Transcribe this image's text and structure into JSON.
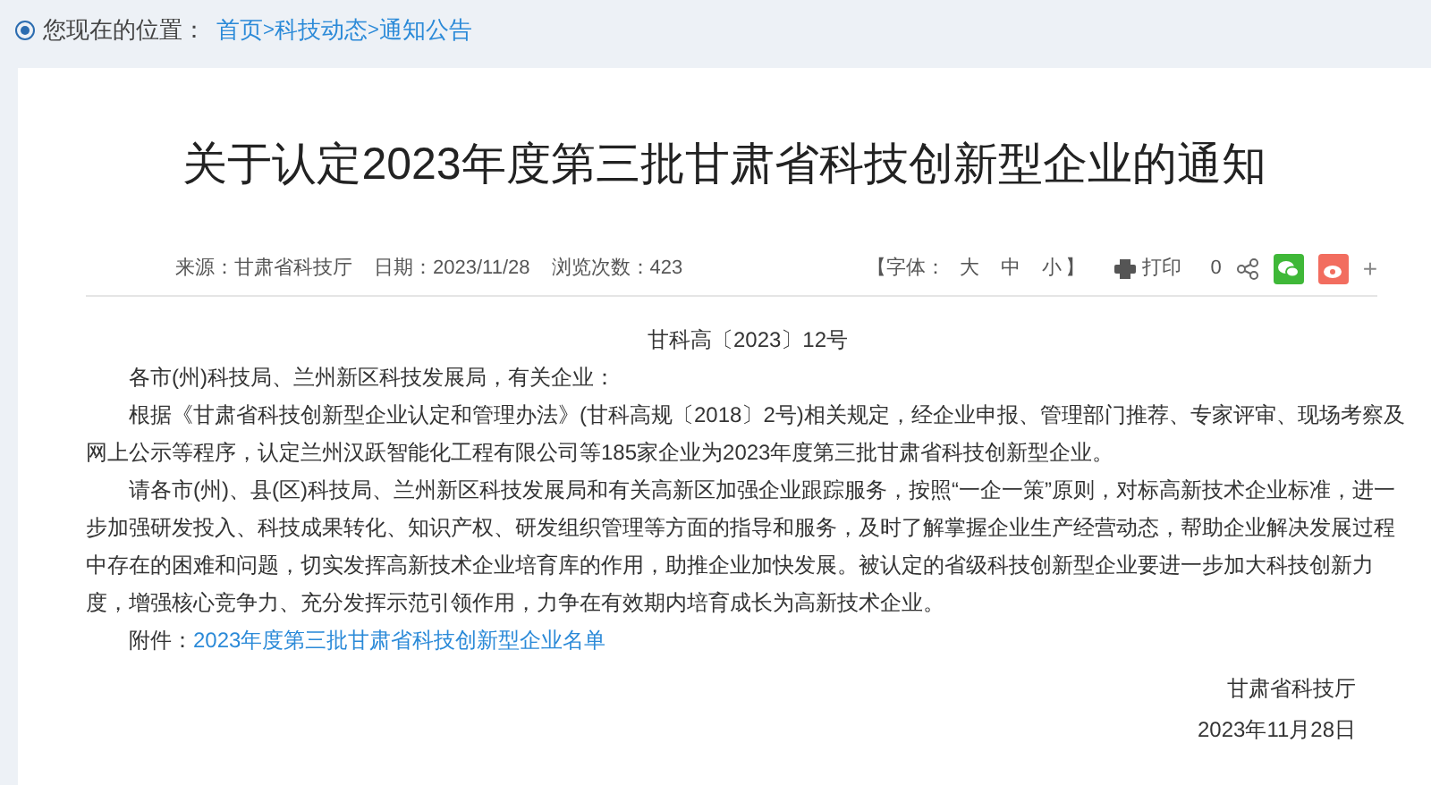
{
  "breadcrumb": {
    "label": "您现在的位置：",
    "links": [
      "首页",
      ">",
      "科技动态",
      ">",
      "通知公告"
    ]
  },
  "title": "关于认定2023年度第三批甘肃省科技创新型企业的通知",
  "meta": {
    "source": "来源：甘肃省科技厅",
    "date": "日期：2023/11/28",
    "views": "浏览次数：423"
  },
  "toolbar": {
    "font_open": "【字体：",
    "font_sizes": [
      "大",
      "中",
      "小"
    ],
    "font_close": "】",
    "print": "打印",
    "share_count": "0",
    "more": "+"
  },
  "doc_number": "甘科高〔2023〕12号",
  "salutation": "各市(州)科技局、兰州新区科技发展局，有关企业：",
  "paragraphs": [
    "根据《甘肃省科技创新型企业认定和管理办法》(甘科高规〔2018〕2号)相关规定，经企业申报、管理部门推荐、专家评审、现场考察及网上公示等程序，认定兰州汉跃智能化工程有限公司等185家企业为2023年度第三批甘肃省科技创新型企业。",
    "请各市(州)、县(区)科技局、兰州新区科技发展局和有关高新区加强企业跟踪服务，按照“一企一策”原则，对标高新技术企业标准，进一步加强研发投入、科技成果转化、知识产权、研发组织管理等方面的指导和服务，及时了解掌握企业生产经营动态，帮助企业解决发展过程中存在的困难和问题，切实发挥高新技术企业培育库的作用，助推企业加快发展。被认定的省级科技创新型企业要进一步加大科技创新力度，增强核心竞争力、充分发挥示范引领作用，力争在有效期内培育成长为高新技术企业。"
  ],
  "attachment": {
    "label": "附件：",
    "link": "2023年度第三批甘肃省科技创新型企业名单"
  },
  "signature": {
    "org": "甘肃省科技厅",
    "date": "2023年11月28日"
  }
}
